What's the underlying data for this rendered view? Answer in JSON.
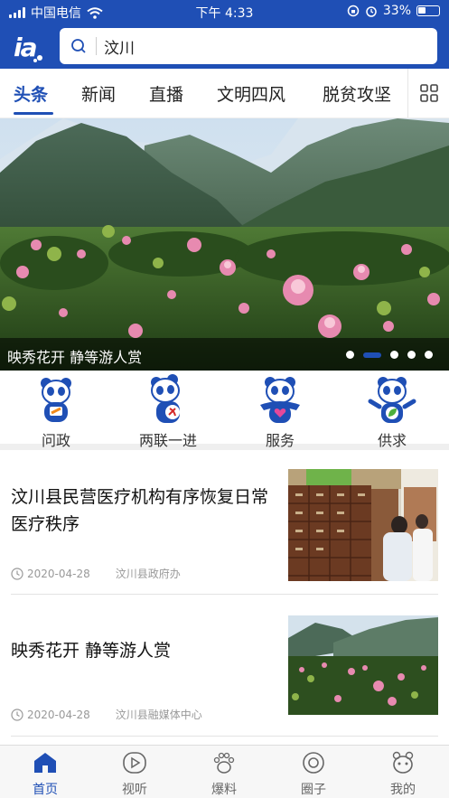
{
  "status_bar": {
    "carrier": "中国电信",
    "time": "下午 4:33",
    "battery": "33%"
  },
  "header": {
    "logo_text": "i a",
    "search_value": "汶川"
  },
  "tabs": [
    {
      "label": "头条"
    },
    {
      "label": "新闻"
    },
    {
      "label": "直播"
    },
    {
      "label": "文明四风"
    },
    {
      "label": "脱贫攻坚"
    }
  ],
  "banner": {
    "caption": "映秀花开 静等游人赏",
    "slides": 5,
    "active_slide": 2
  },
  "quick_actions": [
    {
      "label": "问政"
    },
    {
      "label": "两联一进"
    },
    {
      "label": "服务"
    },
    {
      "label": "供求"
    }
  ],
  "news": [
    {
      "title": "汶川县民营医疗机构有序恢复日常医疗秩序",
      "date": "2020-04-28",
      "source": "汶川县政府办"
    },
    {
      "title": "映秀花开 静等游人赏",
      "date": "2020-04-28",
      "source": "汶川县融媒体中心"
    }
  ],
  "tabbar": [
    {
      "label": "首页"
    },
    {
      "label": "视听"
    },
    {
      "label": "爆料"
    },
    {
      "label": "圈子"
    },
    {
      "label": "我的"
    }
  ],
  "colors": {
    "brand": "#1f4fb5",
    "text": "#111111",
    "muted": "#999999"
  }
}
